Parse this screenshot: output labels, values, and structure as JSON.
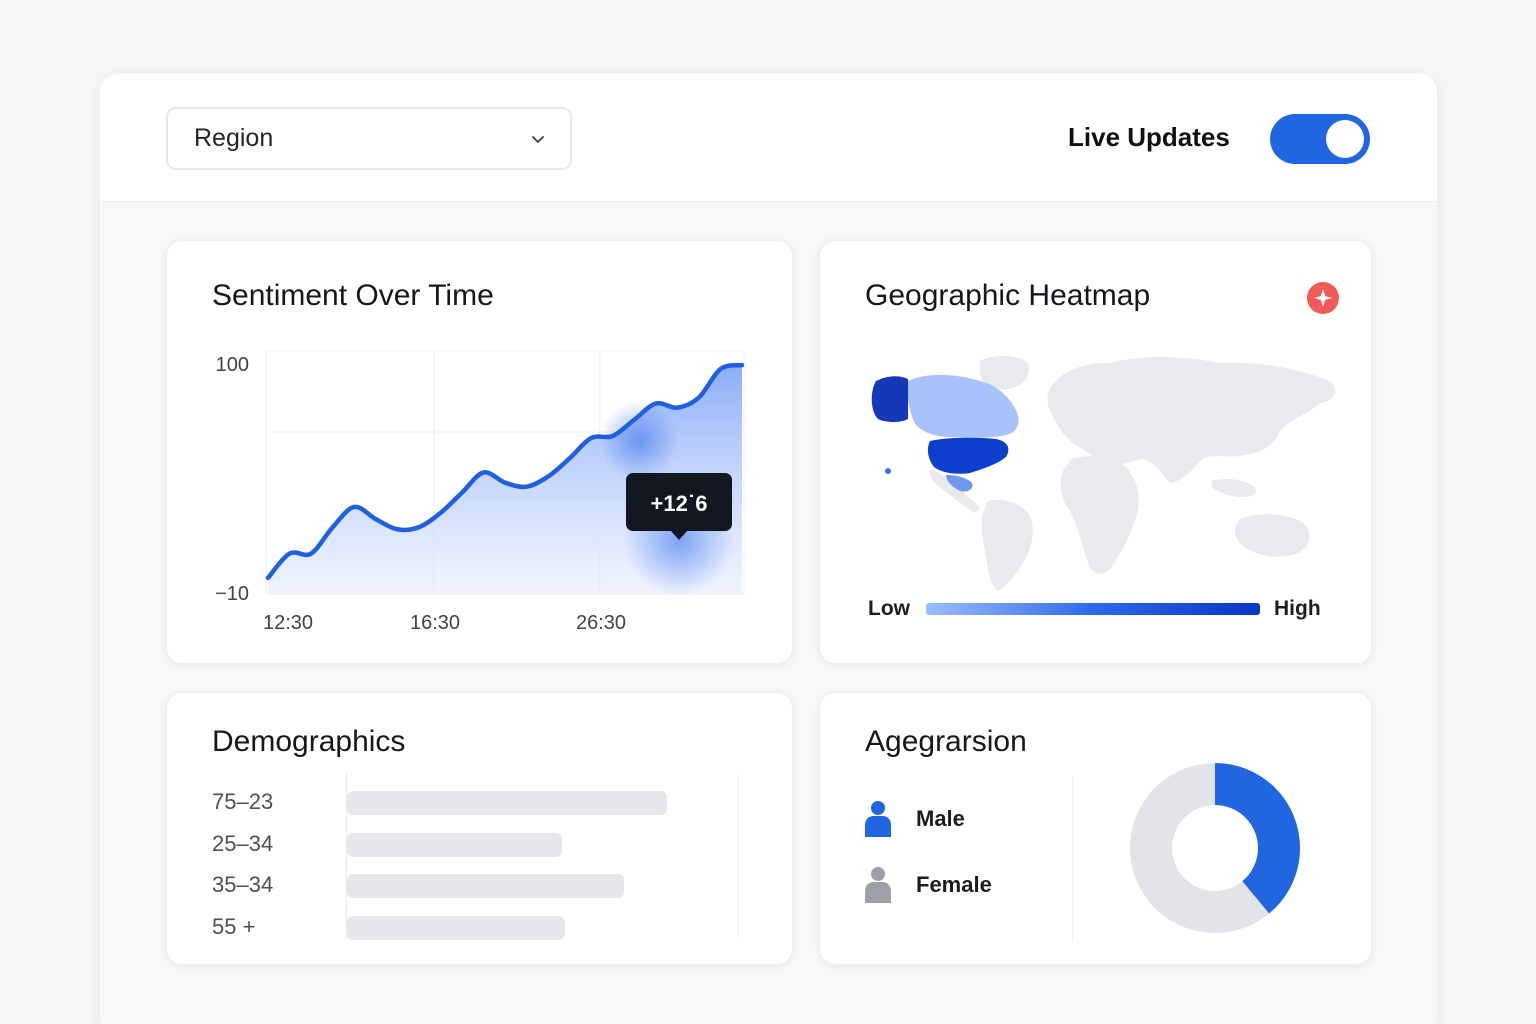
{
  "header": {
    "region_select": {
      "value": "Region",
      "icon": "chevron-down-icon"
    },
    "live_updates": {
      "label": "Live Updates",
      "enabled": true,
      "color": "#1f66e0"
    }
  },
  "sentiment": {
    "title": "Sentiment Over Time",
    "tooltip": "+12˙6"
  },
  "chart_data": {
    "type": "area",
    "title": "Sentiment Over Time",
    "xlabel": "",
    "ylabel": "",
    "y_ticks": [
      "100",
      "−10"
    ],
    "x_ticks": [
      "12:30",
      "16:30",
      "26:30"
    ],
    "ylim": [
      -10,
      100
    ],
    "grid": true,
    "line_color": "#1f5fe0",
    "series": [
      {
        "values": [
          -7,
          5,
          5,
          18,
          28,
          22,
          17,
          18,
          25,
          35,
          45,
          40,
          38,
          43,
          52,
          62,
          63,
          71,
          79,
          77,
          82,
          96,
          98
        ]
      }
    ],
    "annotation": "+12˙6"
  },
  "heatmap": {
    "title": "Geographic Heatmap",
    "alert_icon": "alert-icon",
    "legend_low": "Low",
    "legend_high": "High",
    "colors": {
      "low": "#9dbcff",
      "mid": "#2e6ae8",
      "high": "#0a35c4",
      "land": "#e9eaee"
    }
  },
  "demographics": {
    "title": "Demographics",
    "rows": [
      {
        "label": "75–23",
        "value": 0.82
      },
      {
        "label": "25–34",
        "value": 0.55
      },
      {
        "label": "35–34",
        "value": 0.71
      },
      {
        "label": "55 +",
        "value": 0.56
      }
    ]
  },
  "gender": {
    "title": "Agegrarsion",
    "items": [
      {
        "label": "Male",
        "icon": "male-person-icon",
        "color": "#1f66e0"
      },
      {
        "label": "Female",
        "icon": "female-person-icon",
        "color": "#9ca0a8"
      }
    ],
    "donut": {
      "male_fraction": 0.39,
      "male_color": "#1f66e0",
      "female_color": "#e2e4ea"
    }
  }
}
